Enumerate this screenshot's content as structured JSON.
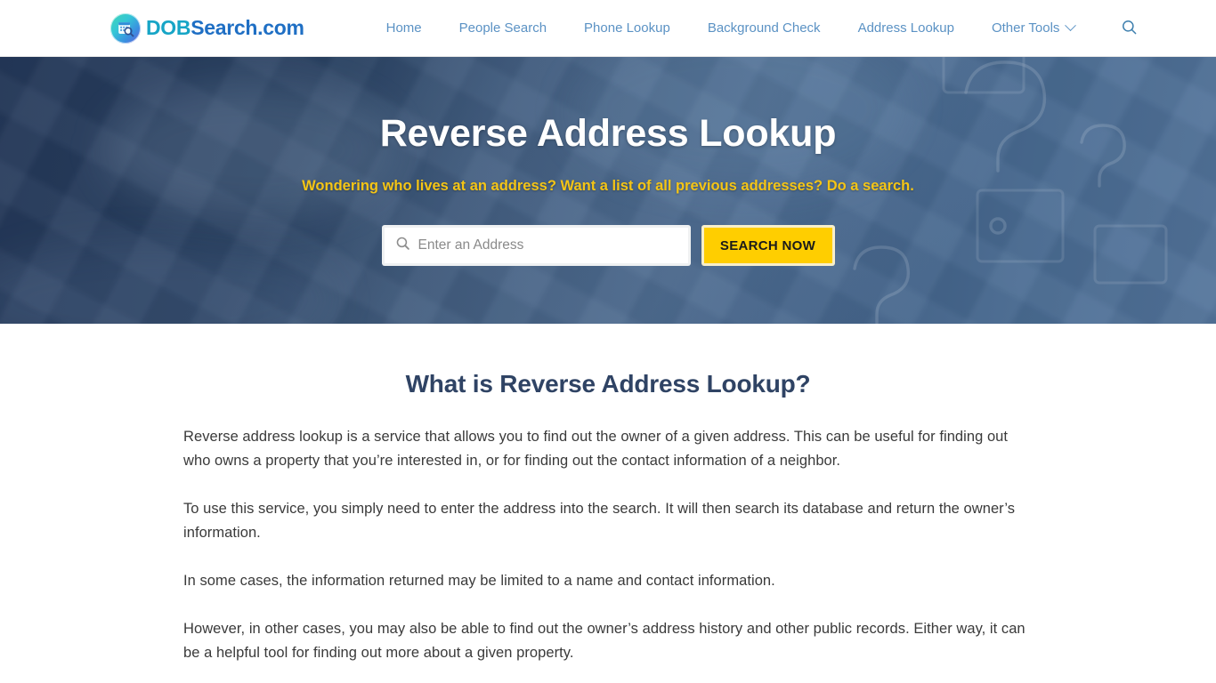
{
  "header": {
    "brand": {
      "icon": "calendar-magnifier-logo-icon",
      "part1": "DOB",
      "part2": "Search",
      "part3": ".com"
    },
    "nav_items": [
      {
        "label": "Home",
        "name": "nav-item-home",
        "has_chevron": false
      },
      {
        "label": "People Search",
        "name": "nav-item-people-search",
        "has_chevron": false
      },
      {
        "label": "Phone Lookup",
        "name": "nav-item-phone-lookup",
        "has_chevron": false
      },
      {
        "label": "Background Check",
        "name": "nav-item-background-check",
        "has_chevron": false
      },
      {
        "label": "Address Lookup",
        "name": "nav-item-address-lookup",
        "has_chevron": false
      },
      {
        "label": "Other Tools",
        "name": "nav-item-other-tools",
        "has_chevron": true
      }
    ],
    "search_icon": "search-icon"
  },
  "hero": {
    "title": "Reverse Address Lookup",
    "subtitle": "Wondering who lives at an address? Want a list of all previous addresses? Do a search.",
    "search": {
      "icon": "search-icon",
      "value": "",
      "placeholder": "Enter an Address",
      "button_label": "SEARCH NOW"
    },
    "colors": {
      "title": "#ffffff",
      "subtitle": "#f5c515",
      "button_bg": "#ffce00",
      "background": "#2b4463"
    }
  },
  "main": {
    "heading": "What is Reverse Address Lookup?",
    "paragraphs": [
      "Reverse address lookup is a service that allows you to find out the owner of a given address. This can be useful for finding out who owns a property that you’re interested in, or for finding out the contact information of a neighbor.",
      "To use this service, you simply need to enter the address into the search. It will then search its database and return the owner’s information.",
      "In some cases, the information returned may be limited to a name and contact information.",
      "However, in other cases, you may also be able to find out the owner’s address history and other public records. Either way, it can be a helpful tool for finding out more about a given property."
    ],
    "heading_color": "#2f4364"
  }
}
